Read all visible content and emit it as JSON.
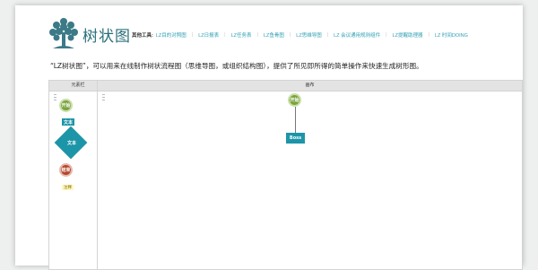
{
  "header": {
    "title": "树状图",
    "tools_label": "其他工具:",
    "tools": [
      "LZ目的对照图",
      "LZ日报表",
      "LZ任务表",
      "LZ鱼骨图",
      "LZ思维导图",
      "LZ 会议通用规则组件",
      "LZ提醒助理器",
      "LZ 时间DOING"
    ]
  },
  "intro": "“LZ树状图”，可以用来在线制作树状流程图（思维导图，或组织结构图），提供了所见即所得的简单操作来快速生成树形图。",
  "elements_panel": {
    "title": "元素栏",
    "items": [
      {
        "label": "开始",
        "shape": "circle",
        "color": "#7aa33c"
      },
      {
        "label": "文本",
        "shape": "rect",
        "color": "#1d95a8"
      },
      {
        "label": "文本",
        "shape": "diamond",
        "color": "#1d95a8"
      },
      {
        "label": "结束",
        "shape": "circle",
        "color": "#b5452b"
      },
      {
        "label": "注释",
        "shape": "note",
        "color": "#fff7c0"
      }
    ]
  },
  "canvas": {
    "title": "画布",
    "nodes": [
      {
        "label": "开始",
        "shape": "circle",
        "color": "#7aa33c"
      },
      {
        "label": "Boss",
        "shape": "rect",
        "color": "#1d95a8"
      }
    ]
  }
}
